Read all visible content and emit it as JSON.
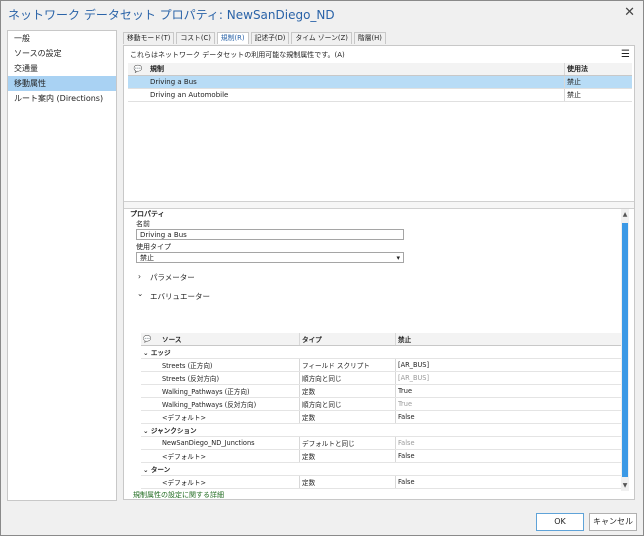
{
  "window": {
    "title": "ネットワーク データセット プロパティ: NewSanDiego_ND",
    "close": "✕"
  },
  "sidebar": {
    "items": [
      {
        "label": "一般"
      },
      {
        "label": "ソースの設定"
      },
      {
        "label": "交通量"
      },
      {
        "label": "移動属性",
        "active": true
      },
      {
        "label": "ルート案内 (Directions)"
      }
    ]
  },
  "tabs": [
    {
      "label": "移動モード(T)"
    },
    {
      "label": "コスト(C)"
    },
    {
      "label": "規制(R)",
      "active": true
    },
    {
      "label": "記述子(D)"
    },
    {
      "label": "タイム ゾーン(Z)"
    },
    {
      "label": "階層(H)"
    }
  ],
  "restrictions": {
    "description": "これらはネットワーク データセットの利用可能な規制属性です。(A)",
    "menu_icon": "☰",
    "columns": {
      "icon": "💬",
      "name": "規制",
      "usage": "使用法"
    },
    "rows": [
      {
        "name": "Driving a Bus",
        "usage": "禁止",
        "selected": true
      },
      {
        "name": "Driving an Automobile",
        "usage": "禁止"
      }
    ]
  },
  "properties": {
    "section_title": "プロパティ",
    "name_label": "名前",
    "name_value": "Driving a Bus",
    "usage_label": "使用タイプ",
    "usage_value": "禁止",
    "dropdown_icon": "▾",
    "parameters_label": "パラメーター",
    "evaluators_label": "エバリュエーター",
    "collapsed_icon": "›",
    "expanded_icon": "⌄"
  },
  "evaluators": {
    "columns": {
      "icon": "💬",
      "source": "ソース",
      "type": "タイプ",
      "prohibited": "禁止"
    },
    "groups": [
      {
        "name": "エッジ",
        "rows": [
          {
            "source": "Streets (正方向)",
            "type": "フィールド スクリプト",
            "value": "[AR_BUS]",
            "gray": false
          },
          {
            "source": "Streets (反対方向)",
            "type": "順方向と同じ",
            "value": "[AR_BUS]",
            "gray": true
          },
          {
            "source": "Walking_Pathways (正方向)",
            "type": "定数",
            "value": "True",
            "gray": false
          },
          {
            "source": "Walking_Pathways (反対方向)",
            "type": "順方向と同じ",
            "value": "True",
            "gray": true
          },
          {
            "source": "<デフォルト>",
            "type": "定数",
            "value": "False",
            "gray": false
          }
        ]
      },
      {
        "name": "ジャンクション",
        "rows": [
          {
            "source": "NewSanDiego_ND_Junctions",
            "type": "デフォルトと同じ",
            "value": "False",
            "gray": true
          },
          {
            "source": "<デフォルト>",
            "type": "定数",
            "value": "False",
            "gray": false
          }
        ]
      },
      {
        "name": "ターン",
        "rows": [
          {
            "source": "<デフォルト>",
            "type": "定数",
            "value": "False",
            "gray": false
          }
        ]
      }
    ]
  },
  "footer": {
    "link": "規制属性の設定に関する詳細",
    "ok": "OK",
    "cancel": "キャンセル"
  }
}
